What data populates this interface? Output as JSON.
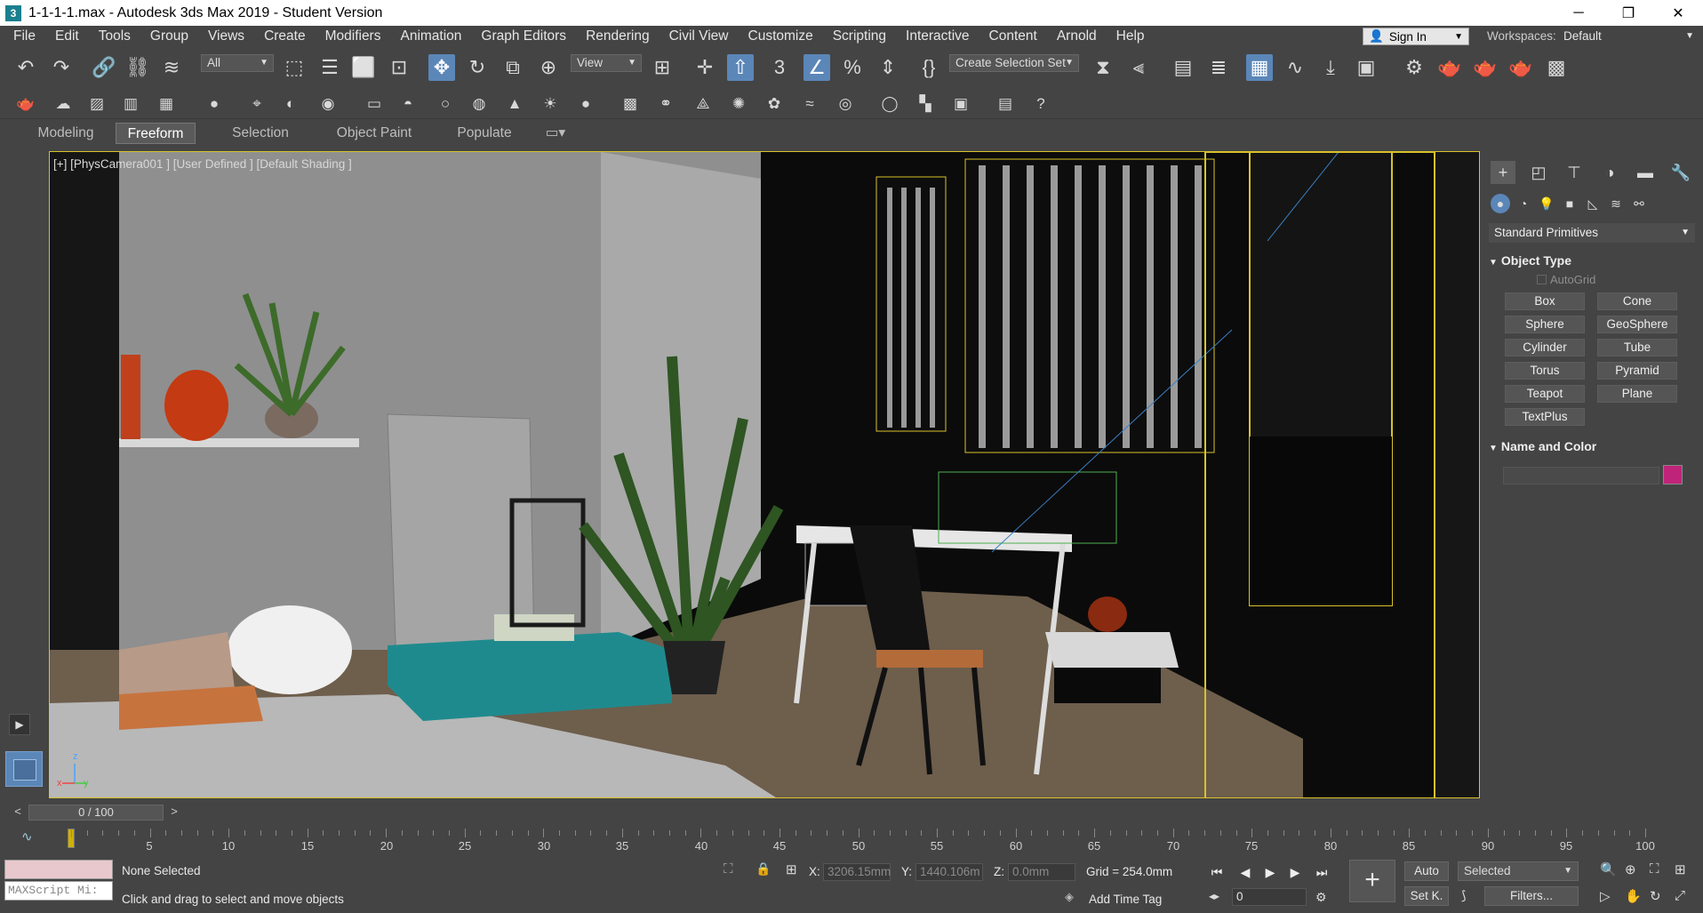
{
  "window": {
    "title": "1-1-1-1.max - Autodesk 3ds Max 2019 - Student Version",
    "app_icon": "3",
    "minimize": "─",
    "maximize": "❐",
    "close": "✕"
  },
  "menu": {
    "items": [
      "File",
      "Edit",
      "Tools",
      "Group",
      "Views",
      "Create",
      "Modifiers",
      "Animation",
      "Graph Editors",
      "Rendering",
      "Civil View",
      "Customize",
      "Scripting",
      "Interactive",
      "Content",
      "Arnold",
      "Help"
    ],
    "sign_in": "Sign In",
    "workspaces_label": "Workspaces:",
    "workspace_value": "Default"
  },
  "toolbar": {
    "selection_filter": "All",
    "ref_coord": "View",
    "selection_set": "Create Selection Set"
  },
  "ribbon": {
    "tabs": [
      "Modeling",
      "Freeform",
      "Selection",
      "Object Paint",
      "Populate"
    ],
    "active_tab": "Freeform"
  },
  "viewport": {
    "label": "[+] [PhysCamera001 ] [User Defined ] [Default Shading ]",
    "axis_x": "x",
    "axis_y": "y",
    "axis_z": "z"
  },
  "command_panel": {
    "category": "Standard Primitives",
    "object_type_title": "Object Type",
    "autogrid": "AutoGrid",
    "buttons": [
      "Box",
      "Cone",
      "Sphere",
      "GeoSphere",
      "Cylinder",
      "Tube",
      "Torus",
      "Pyramid",
      "Teapot",
      "Plane",
      "TextPlus"
    ],
    "name_color_title": "Name and Color",
    "name_value": "",
    "object_color": "#c0247a"
  },
  "timeline": {
    "frame_display": "0 / 100",
    "prev": "<",
    "next": ">",
    "ticks": [
      "5",
      "10",
      "15",
      "20",
      "25",
      "30",
      "35",
      "40",
      "45",
      "50",
      "55",
      "60",
      "65",
      "70",
      "75",
      "80",
      "85",
      "90",
      "95",
      "100"
    ]
  },
  "status": {
    "maxscript_placeholder": "MAXScript Mi:",
    "selection": "None Selected",
    "prompt": "Click and drag to select and move objects",
    "x_label": "X:",
    "x_value": "3206.15mm",
    "y_label": "Y:",
    "y_value": "1440.106m",
    "z_label": "Z:",
    "z_value": "0.0mm",
    "grid": "Grid = 254.0mm",
    "add_time_tag": "Add Time Tag",
    "auto": "Auto",
    "set_key": "Set K.",
    "key_filter": "Selected",
    "filters": "Filters...",
    "frame_value": "0"
  }
}
